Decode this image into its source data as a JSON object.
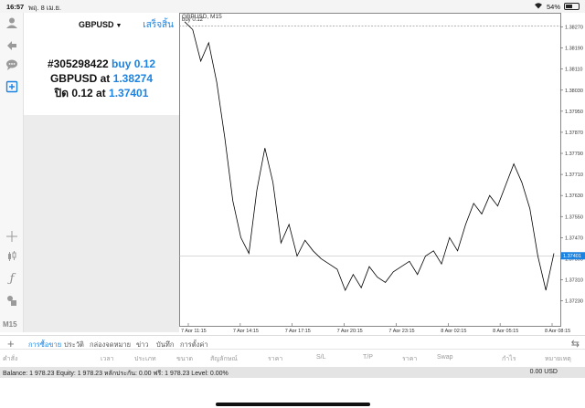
{
  "status_bar": {
    "time": "16:57",
    "date": "พฤ. 8 เม.ย.",
    "battery_text": "54%",
    "battery_level": 0.54
  },
  "toolbar": {
    "timeframe": "M15",
    "icons": [
      "user-icon",
      "trade-icon",
      "chat-icon",
      "new-order-icon",
      "crosshair-icon",
      "candles-icon",
      "function-icon",
      "objects-icon"
    ]
  },
  "order": {
    "symbol": "GBPUSD",
    "done_label": "เสร็จสิ้น",
    "ticket": "#305298422",
    "side_volume": "buy 0.12",
    "open_line_symbol": "GBPUSD at",
    "open_price": "1.38274",
    "close_label": "ปิด 0.12 at",
    "close_price": "1.37401"
  },
  "chart": {
    "title": "GBPUSD, M15",
    "order_label": "buy 0.12",
    "current_price": "1.37401",
    "colors": {
      "line": "#000000",
      "order_line": "#9a9a9a",
      "price_tag": "#1d83e0"
    }
  },
  "chart_data": {
    "type": "line",
    "title": "GBPUSD, M15",
    "xlabel": "",
    "ylabel": "",
    "ylim": [
      1.3718,
      1.3831
    ],
    "y_ticks": [
      "1.38270",
      "1.38190",
      "1.38110",
      "1.38030",
      "1.37950",
      "1.37870",
      "1.37790",
      "1.37710",
      "1.37630",
      "1.37550",
      "1.37470",
      "1.37390",
      "1.37310",
      "1.37230"
    ],
    "x_ticks": [
      "7 Apr 11:15",
      "7 Apr 14:15",
      "7 Apr 17:15",
      "7 Apr 20:15",
      "7 Apr 23:15",
      "8 Apr 02:15",
      "8 Apr 05:15",
      "8 Apr 08:15"
    ],
    "x": [
      "7 Apr 09:30",
      "7 Apr 10:00",
      "7 Apr 10:30",
      "7 Apr 11:00",
      "7 Apr 11:30",
      "7 Apr 12:00",
      "7 Apr 12:30",
      "7 Apr 13:00",
      "7 Apr 13:30",
      "7 Apr 14:00",
      "7 Apr 14:30",
      "7 Apr 15:00",
      "7 Apr 15:30",
      "7 Apr 16:00",
      "7 Apr 16:30",
      "7 Apr 17:00",
      "7 Apr 17:30",
      "7 Apr 18:00",
      "7 Apr 18:30",
      "7 Apr 19:00",
      "7 Apr 19:30",
      "7 Apr 20:00",
      "7 Apr 20:30",
      "7 Apr 21:00",
      "7 Apr 21:30",
      "7 Apr 22:00",
      "7 Apr 22:30",
      "7 Apr 23:00",
      "7 Apr 23:30",
      "8 Apr 00:00",
      "8 Apr 00:30",
      "8 Apr 01:00",
      "8 Apr 01:30",
      "8 Apr 02:00",
      "8 Apr 02:30",
      "8 Apr 03:00",
      "8 Apr 03:30",
      "8 Apr 04:00",
      "8 Apr 04:30",
      "8 Apr 05:00",
      "8 Apr 05:30",
      "8 Apr 06:00",
      "8 Apr 06:30",
      "8 Apr 07:00",
      "8 Apr 07:30",
      "8 Apr 08:00",
      "8 Apr 08:30"
    ],
    "values": [
      1.3829,
      1.3826,
      1.3814,
      1.3821,
      1.3806,
      1.3785,
      1.3761,
      1.3747,
      1.3741,
      1.3765,
      1.3781,
      1.3768,
      1.3745,
      1.3752,
      1.374,
      1.3746,
      1.3742,
      1.3739,
      1.3737,
      1.3735,
      1.3727,
      1.3733,
      1.3728,
      1.3736,
      1.3732,
      1.373,
      1.3734,
      1.3736,
      1.3738,
      1.3733,
      1.374,
      1.3742,
      1.3737,
      1.3747,
      1.3742,
      1.3752,
      1.376,
      1.3756,
      1.3763,
      1.3759,
      1.3767,
      1.3775,
      1.3768,
      1.3758,
      1.374,
      1.3727,
      1.3741
    ]
  },
  "tabs": {
    "items": [
      "การซื้อขาย",
      "ประวัติ",
      "กล่องจดหมาย",
      "ข่าว",
      "บันทึก",
      "การตั้งค่า"
    ],
    "active": "การซื้อขาย"
  },
  "columns": [
    "คำสั่ง",
    "เวลา",
    "ประเภท",
    "ขนาด",
    "สัญลักษณ์",
    "ราคา",
    "S/L",
    "T/P",
    "ราคา",
    "Swap",
    "กำไร",
    "หมายเหตุ"
  ],
  "balance": {
    "text": "Balance: 1 978.23  Equity: 1 978.23  หลักประกัน: 0.00  ฟรี: 1 978.23  Level: 0.00%",
    "value": "0.00  USD"
  }
}
